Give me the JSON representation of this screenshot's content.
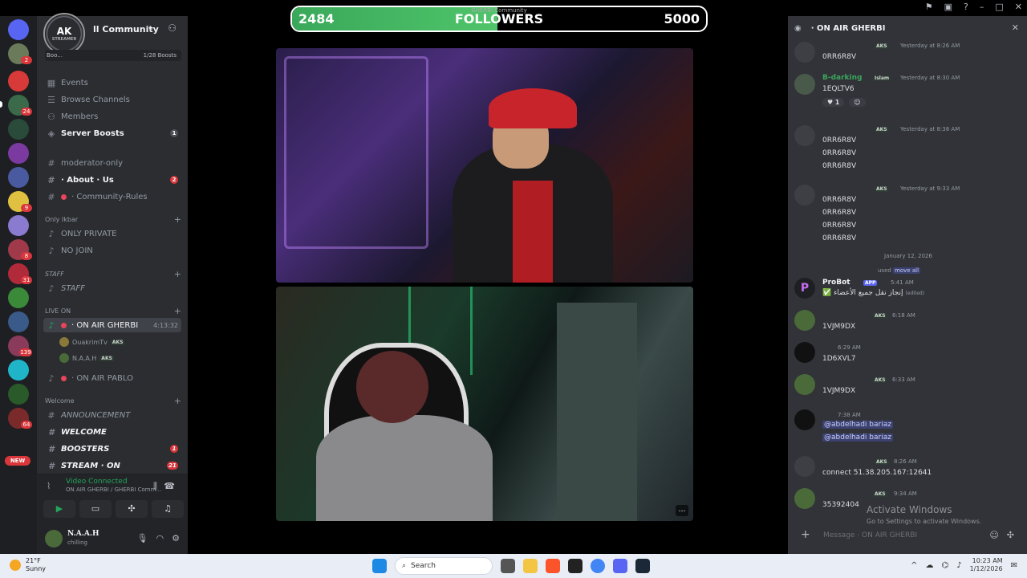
{
  "server": {
    "name": "ll Community",
    "logo_text": "AK",
    "logo_sub": "STREAMER",
    "boosts_label": "Boo...",
    "boosts_count": "1/28 Boosts"
  },
  "rail": {
    "badges": [
      "2",
      "24",
      "9",
      "8",
      "31",
      "139",
      "64"
    ],
    "new_label": "NEW"
  },
  "channels": [
    {
      "label": "Events",
      "icon": "calendar-icon"
    },
    {
      "label": "Browse Channels",
      "icon": "browse-icon"
    },
    {
      "label": "Members",
      "icon": "members-icon"
    },
    {
      "label": "Server Boosts",
      "icon": "boost-icon",
      "count": "1"
    },
    {
      "label": "moderator-only",
      "icon": "hash-icon"
    },
    {
      "label": "· About · Us",
      "icon": "hash-icon",
      "count": "2"
    },
    {
      "label": "· Community-Rules",
      "icon": "hash-icon"
    },
    {
      "label": "ONLY PRIVATE",
      "icon": "speaker-icon"
    },
    {
      "label": "NO JOIN",
      "icon": "speaker-icon"
    },
    {
      "label": "STAFF",
      "icon": "speaker-icon"
    },
    {
      "label": "· ON AIR GHERBI",
      "icon": "speaker-icon",
      "time": "4:13:32"
    },
    {
      "label": "· ON AIR PABLO",
      "icon": "speaker-icon"
    },
    {
      "label": "ANNOUNCEMENT",
      "icon": "hash-icon"
    },
    {
      "label": "WELCOME",
      "icon": "hash-icon"
    },
    {
      "label": "BOOSTERS",
      "icon": "hash-icon",
      "count": "1"
    },
    {
      "label": "STREAM · ON",
      "icon": "hash-icon",
      "count": "21"
    }
  ],
  "categories": {
    "only": "Only Ikbar",
    "staff": "STAFF",
    "live": "LIVE ON",
    "welcome": "Welcome"
  },
  "voice_users": [
    {
      "name": "OuakrimTv",
      "tag": "AKS"
    },
    {
      "name": "N.A.A.H",
      "tag": "AKS"
    }
  ],
  "voice_panel": {
    "status": "Video Connected",
    "sub": "ON AIR GHERBI / GHERBI Comm..."
  },
  "user": {
    "name": "N.A.A.H",
    "status": "chilling"
  },
  "stream": {
    "followers_current": "2484",
    "followers_label": "FOLLOWERS",
    "followers_goal": "5000",
    "followers_progress": 0.4968,
    "overlay_small": "GHERBI Community"
  },
  "chat": {
    "title": "· ON AIR GHERBI",
    "messages": [
      {
        "name": "",
        "tag": "AKS",
        "time": "Yesterday at 8:26 AM",
        "lines": [
          "0RR6R8V"
        ]
      },
      {
        "name": "B-darking",
        "tag": "Islam",
        "time": "Yesterday at 8:30 AM",
        "lines": [
          "1EQLTV6"
        ],
        "reaction": "1"
      },
      {
        "name": "",
        "tag": "AKS",
        "time": "Yesterday at 8:38 AM",
        "lines": [
          "0RR6R8V",
          "0RR6R8V",
          "0RR6R8V"
        ]
      },
      {
        "name": "",
        "tag": "AKS",
        "time": "Yesterday at 9:33 AM",
        "lines": [
          "0RR6R8V",
          "0RR6R8V",
          "0RR6R8V",
          "0RR6R8V"
        ]
      }
    ],
    "date_divider": "January 12, 2026",
    "probot": {
      "used": "used",
      "cmd": "move all",
      "name": "ProBot",
      "app": "APP",
      "time": "5:41 AM",
      "line": "إنجاز نقل جميع الأعضاء",
      "edited": "(edited)"
    },
    "later": [
      {
        "tag": "AKS",
        "time": "6:18 AM",
        "line": "1VJM9DX"
      },
      {
        "tag": "",
        "time": "6:29 AM",
        "line": "1D6XVL7"
      },
      {
        "tag": "AKS",
        "time": "6:33 AM",
        "line": "1VJM9DX"
      },
      {
        "tag": "",
        "time": "7:38 AM",
        "mention1": "@abdelhadi bariaz",
        "mention2": "@abdelhadi bariaz"
      },
      {
        "tag": "AKS",
        "time": "8:26 AM",
        "line": "connect 51.38.205.167:12641"
      },
      {
        "tag": "AKS",
        "time": "9:34 AM",
        "line": "35392404"
      }
    ],
    "input_placeholder": "Message · ON AIR GHERBI",
    "activate_title": "Activate Windows",
    "activate_sub": "Go to Settings to activate Windows."
  },
  "taskbar": {
    "temp": "21°F",
    "weather": "Sunny",
    "search": "Search",
    "time": "10:23 AM",
    "date": "1/12/2026"
  }
}
